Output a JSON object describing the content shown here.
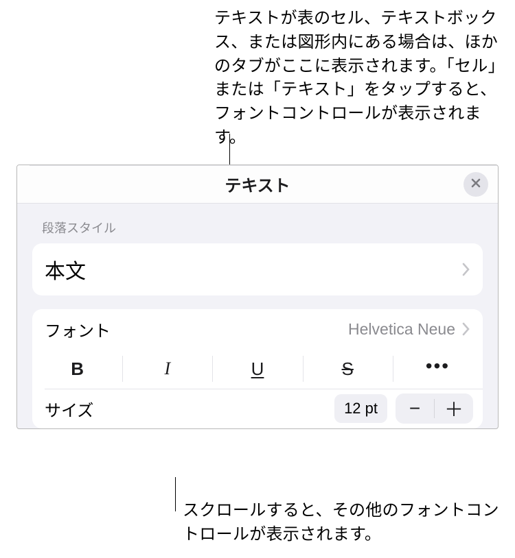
{
  "annotations": {
    "top": "テキストが表のセル、テキストボックス、または図形内にある場合は、ほかのタブがここに表示されます。「セル」または「テキスト」をタップすると、フォントコントロールが表示されます。",
    "bottom": "スクロールすると、その他のフォントコントロールが表示されます。"
  },
  "panel": {
    "title": "テキスト",
    "paragraphStyleLabel": "段落スタイル",
    "paragraphStyleValue": "本文",
    "fontLabel": "フォント",
    "fontValue": "Helvetica Neue",
    "styleButtons": {
      "bold": "B",
      "italic": "I",
      "underline": "U",
      "strike": "S",
      "more": "•••"
    },
    "sizeLabel": "サイズ",
    "sizeValue": "12 pt",
    "stepper": {
      "minus": "−",
      "plus": "＋"
    }
  }
}
